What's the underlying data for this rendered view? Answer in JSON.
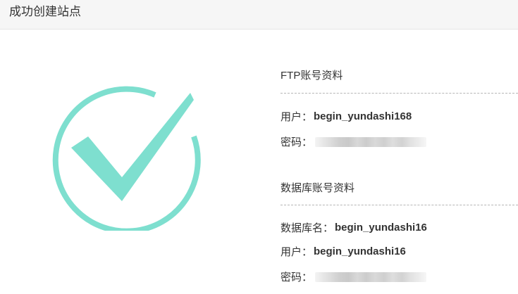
{
  "header": {
    "title": "成功创建站点"
  },
  "success_graphic": {
    "icon": "checkmark-circle",
    "color": "#7edfcf"
  },
  "ftp": {
    "section_title": "FTP账号资料",
    "user_label": "用户：",
    "user_value": "begin_yundashi168",
    "password_label": "密码："
  },
  "database": {
    "section_title": "数据库账号资料",
    "name_label": "数据库名：",
    "name_value": "begin_yundashi16",
    "user_label": "用户：",
    "user_value": "begin_yundashi16",
    "password_label": "密码："
  }
}
